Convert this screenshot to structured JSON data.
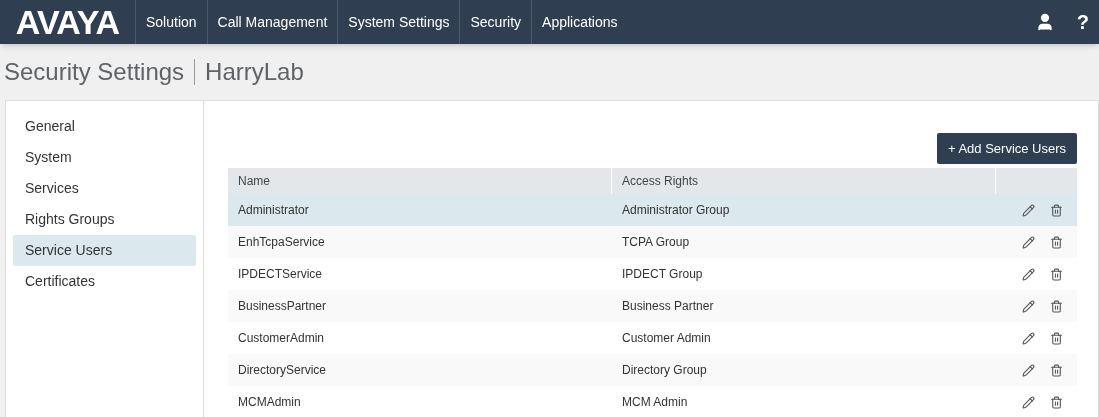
{
  "logo": "AVAYA",
  "nav": [
    {
      "label": "Solution"
    },
    {
      "label": "Call Management"
    },
    {
      "label": "System Settings"
    },
    {
      "label": "Security"
    },
    {
      "label": "Applications"
    }
  ],
  "help": "?",
  "page_title": "Security Settings",
  "system_name": "HarryLab",
  "sidebar": {
    "items": [
      {
        "label": "General",
        "selected": false
      },
      {
        "label": "System",
        "selected": false
      },
      {
        "label": "Services",
        "selected": false
      },
      {
        "label": "Rights Groups",
        "selected": false
      },
      {
        "label": "Service Users",
        "selected": true
      },
      {
        "label": "Certificates",
        "selected": false
      }
    ]
  },
  "add_button": "+ Add Service Users",
  "table": {
    "columns": [
      "Name",
      "Access Rights"
    ],
    "rows": [
      {
        "name": "Administrator",
        "access": "Administrator Group",
        "selected": true
      },
      {
        "name": "EnhTcpaService",
        "access": "TCPA Group",
        "selected": false
      },
      {
        "name": "IPDECTService",
        "access": "IPDECT Group",
        "selected": false
      },
      {
        "name": "BusinessPartner",
        "access": "Business Partner",
        "selected": false
      },
      {
        "name": "CustomerAdmin",
        "access": "Customer Admin",
        "selected": false
      },
      {
        "name": "DirectoryService",
        "access": "Directory Group",
        "selected": false
      },
      {
        "name": "MCMAdmin",
        "access": "MCM Admin",
        "selected": false
      }
    ]
  }
}
